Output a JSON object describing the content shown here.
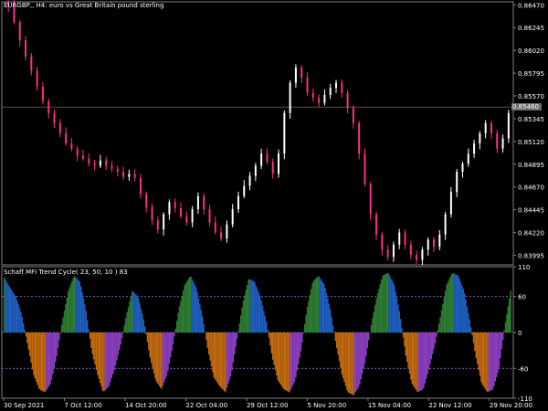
{
  "symbol_title": "EURGBP,, H4:  euro vs Great Britain pound sterling",
  "indicator_title": "Schaff MFI Trend Cycle( 23, 50, 10 ) 83",
  "current_price_label": "0.85460",
  "colors": {
    "background": "#000000",
    "candle_bull": "#ffffff",
    "candle_bear": "#ff2d8a",
    "grid": "#808080",
    "level_line": "#b36bff",
    "hist_green": "#2e7d32",
    "hist_blue": "#1f5fbf",
    "hist_orange": "#c26a10",
    "hist_purple": "#8a3fbf"
  },
  "price_axis": {
    "ticks": [
      "0.86470",
      "0.86245",
      "0.86020",
      "0.85795",
      "0.85570",
      "0.85345",
      "0.85120",
      "0.84895",
      "0.84670",
      "0.84445",
      "0.84220",
      "0.83995"
    ],
    "min": 0.839,
    "max": 0.865
  },
  "indicator_axis": {
    "ticks": [
      "110",
      "60",
      "0",
      "-60",
      "-110"
    ],
    "levels": [
      60,
      -60
    ],
    "min": -110,
    "max": 110
  },
  "time_axis": {
    "labels": [
      "30 Sep 2021",
      "7 Oct 12:00",
      "14 Oct 20:00",
      "22 Oct 04:00",
      "29 Oct 12:00",
      "5 Nov 20:00",
      "15 Nov 04:00",
      "22 Nov 12:00",
      "29 Nov 20:00"
    ]
  },
  "chart_data": {
    "type": "candlestick",
    "title": "EURGBP,, H4:  euro vs Great Britain pound sterling",
    "price_close_path": [
      0.8646,
      0.863,
      0.8612,
      0.8596,
      0.8582,
      0.8566,
      0.8552,
      0.854,
      0.853,
      0.852,
      0.851,
      0.8505,
      0.8498,
      0.8495,
      0.849,
      0.8488,
      0.8493,
      0.8488,
      0.8485,
      0.8482,
      0.8477,
      0.848,
      0.8476,
      0.846,
      0.8447,
      0.8434,
      0.8425,
      0.844,
      0.8452,
      0.8446,
      0.8438,
      0.8432,
      0.8445,
      0.8458,
      0.8445,
      0.8432,
      0.8422,
      0.8416,
      0.843,
      0.8445,
      0.8458,
      0.8468,
      0.8478,
      0.8488,
      0.85,
      0.8492,
      0.848,
      0.85,
      0.854,
      0.857,
      0.8585,
      0.8575,
      0.856,
      0.8555,
      0.855,
      0.8558,
      0.8565,
      0.857,
      0.856,
      0.8545,
      0.853,
      0.85,
      0.847,
      0.844,
      0.842,
      0.8405,
      0.8398,
      0.841,
      0.8422,
      0.841,
      0.84,
      0.8395,
      0.8405,
      0.8415,
      0.8408,
      0.842,
      0.844,
      0.8462,
      0.8482,
      0.849,
      0.85,
      0.851,
      0.852,
      0.853,
      0.852,
      0.8505,
      0.8515,
      0.854
    ],
    "indicator": {
      "name": "Schaff MFI Trend Cycle( 23, 50, 10 ) 83",
      "type": "histogram",
      "values": [
        92,
        75,
        60,
        30,
        -20,
        -70,
        -95,
        -100,
        -85,
        -40,
        20,
        70,
        95,
        85,
        40,
        -30,
        -70,
        -100,
        -90,
        -60,
        -20,
        30,
        70,
        60,
        20,
        -40,
        -80,
        -95,
        -70,
        -20,
        40,
        80,
        95,
        75,
        30,
        -30,
        -75,
        -90,
        -100,
        -70,
        -10,
        50,
        90,
        85,
        60,
        20,
        -40,
        -80,
        -95,
        -100,
        -80,
        -30,
        40,
        85,
        95,
        80,
        40,
        -20,
        -70,
        -100,
        -105,
        -90,
        -50,
        10,
        60,
        95,
        100,
        80,
        30,
        -40,
        -85,
        -100,
        -95,
        -60,
        -20,
        30,
        80,
        100,
        95,
        70,
        20,
        -40,
        -85,
        -100,
        -95,
        -60,
        10,
        70
      ]
    },
    "ylim_price": [
      0.839,
      0.865
    ],
    "ylim_indicator": [
      -110,
      110
    ],
    "grid": false
  }
}
